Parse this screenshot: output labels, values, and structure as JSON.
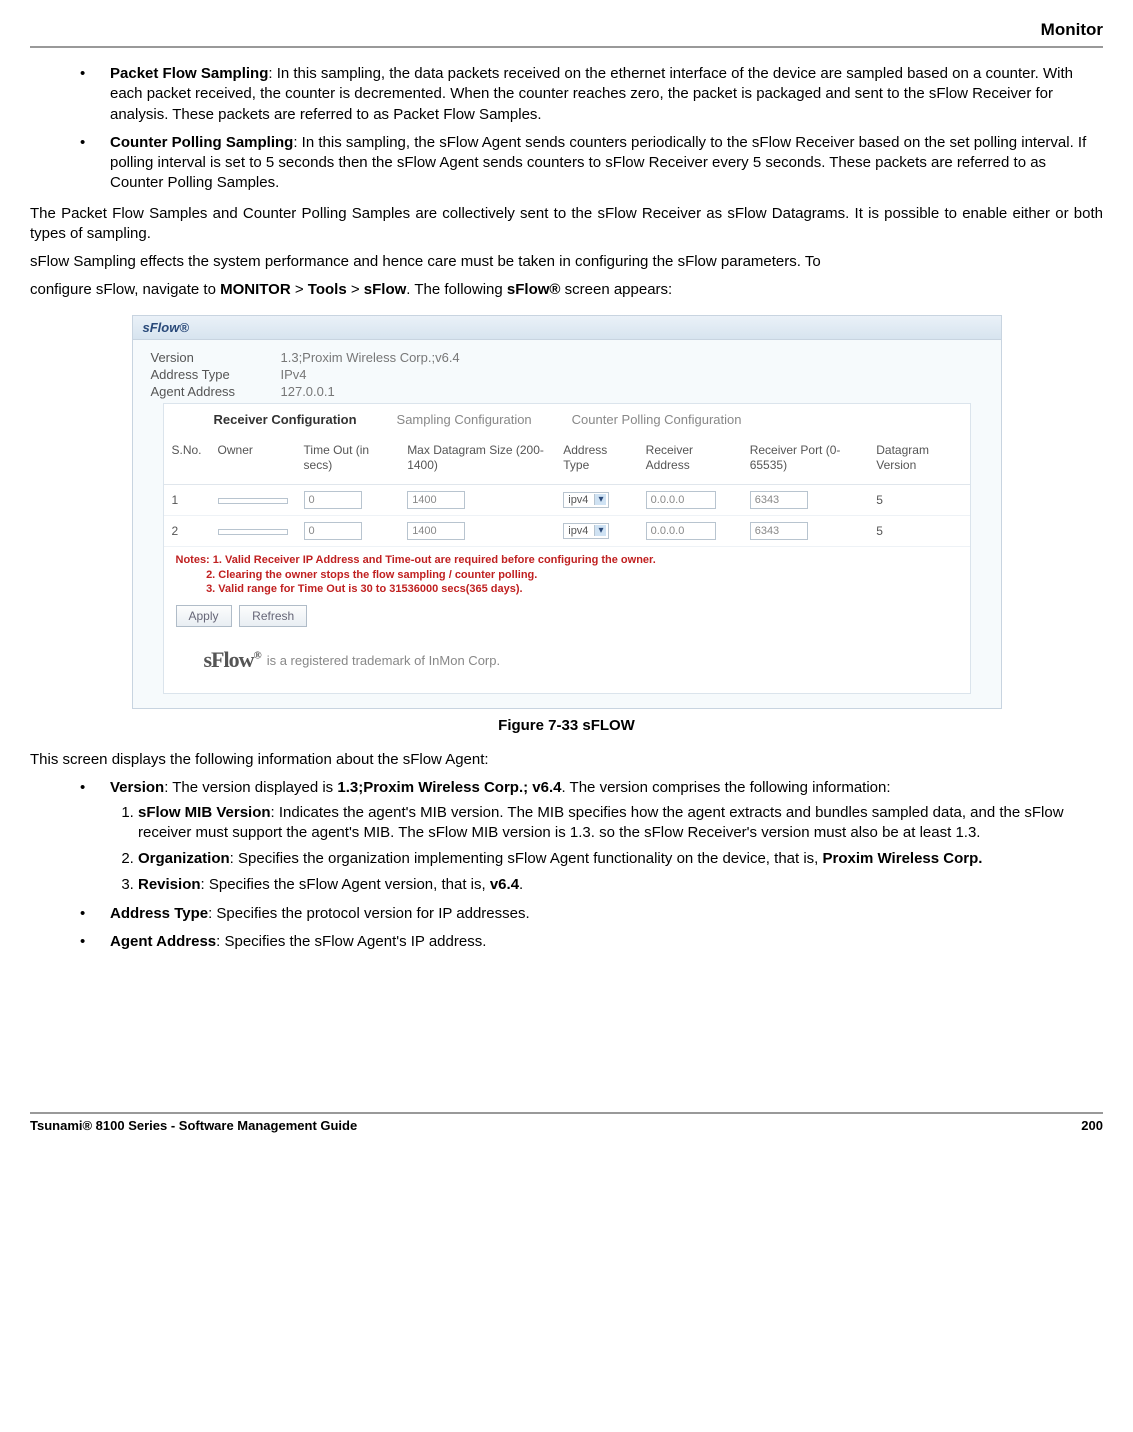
{
  "header": {
    "section": "Monitor"
  },
  "bullets_top": [
    {
      "title": "Packet Flow Sampling",
      "text": ": In this sampling, the data packets received on the ethernet interface of the device are sampled based on a counter. With each packet received, the counter is decremented. When the counter reaches zero, the packet is packaged and sent to the sFlow Receiver for analysis. These packets are referred to as Packet Flow Samples."
    },
    {
      "title": "Counter Polling Sampling",
      "text": ": In this sampling, the sFlow Agent sends counters periodically to the sFlow Receiver based on the set polling interval. If polling interval is set to 5 seconds then the sFlow Agent sends counters to sFlow Receiver every 5 seconds. These packets are referred to as Counter Polling Samples."
    }
  ],
  "para1": "The Packet Flow Samples and Counter Polling Samples are collectively sent to the sFlow Receiver as sFlow Datagrams.   It is possible to enable either or both types of sampling.",
  "para2": "sFlow Sampling effects the system performance and hence care must be taken in configuring the sFlow parameters. To",
  "para3_prefix": "configure sFlow, navigate to ",
  "nav": {
    "l1": "MONITOR",
    "sep": " > ",
    "l2": "Tools",
    "l3": "sFlow"
  },
  "para3_mid": ". The following ",
  "para3_bold": "sFlow®",
  "para3_suffix": " screen appears:",
  "panel": {
    "title": "sFlow®",
    "info": [
      {
        "label": "Version",
        "value": "1.3;Proxim Wireless Corp.;v6.4"
      },
      {
        "label": "Address Type",
        "value": "IPv4"
      },
      {
        "label": "Agent Address",
        "value": "127.0.0.1"
      }
    ],
    "tabs": [
      "Receiver Configuration",
      "Sampling Configuration",
      "Counter Polling Configuration"
    ],
    "columns": [
      "S.No.",
      "Owner",
      "Time Out (in secs)",
      "Max Datagram Size (200-1400)",
      "Address Type",
      "Receiver Address",
      "Receiver Port (0-65535)",
      "Datagram Version"
    ],
    "rows": [
      {
        "sno": "1",
        "owner": "",
        "timeout": "0",
        "maxdg": "1400",
        "addrtype": "ipv4",
        "recvaddr": "0.0.0.0",
        "port": "6343",
        "ver": "5"
      },
      {
        "sno": "2",
        "owner": "",
        "timeout": "0",
        "maxdg": "1400",
        "addrtype": "ipv4",
        "recvaddr": "0.0.0.0",
        "port": "6343",
        "ver": "5"
      }
    ],
    "notes_title": "Notes:",
    "notes": [
      "1. Valid Receiver IP Address and Time-out are required before configuring the owner.",
      "2. Clearing the owner stops the flow sampling / counter polling.",
      "3. Valid range for Time Out is 30 to 31536000 secs(365 days)."
    ],
    "buttons": {
      "apply": "Apply",
      "refresh": "Refresh"
    },
    "trademark": " is a registered trademark of InMon Corp."
  },
  "figure_caption": "Figure 7-33 sFLOW",
  "para4": "This screen displays the following information about the sFlow Agent:",
  "version_bullet": {
    "title": "Version",
    "text_prefix": ": The version displayed is ",
    "bold": "1.3;Proxim Wireless Corp.; v6.4",
    "text_suffix": ". The version comprises the following information:"
  },
  "version_sub": [
    {
      "title": "sFlow MIB Version",
      "text": ": Indicates the agent's MIB version. The MIB specifies how the agent extracts and bundles sampled data, and the sFlow receiver must support the agent's MIB. The sFlow MIB version is 1.3. so the sFlow Receiver's version must also be at least 1.3."
    },
    {
      "title": "Organization",
      "text": ": Specifies the organization implementing sFlow Agent functionality on the device, that is, ",
      "bold_tail": "Proxim Wireless Corp."
    },
    {
      "title": "Revision",
      "text_prefix": ": Specifies the sFlow Agent version, that is, ",
      "bold": "v6.4",
      "text_suffix": "."
    }
  ],
  "bullets_bottom": [
    {
      "title": "Address Type",
      "text": ": Specifies the protocol version for IP addresses."
    },
    {
      "title": "Agent Address",
      "text": ": Specifies the sFlow Agent's IP address."
    }
  ],
  "footer": {
    "left": "Tsunami® 8100 Series - Software Management Guide",
    "right": "200"
  }
}
